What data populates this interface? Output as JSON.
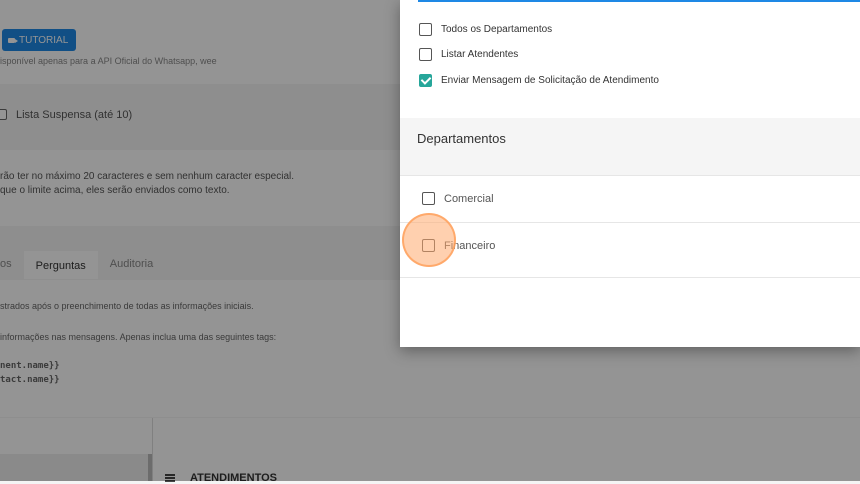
{
  "background": {
    "tutorial_button": "TUTORIAL",
    "api_note": "isponível apenas para a API Oficial do Whatsapp, wee",
    "list_option": "Lista Suspensa (até 10)",
    "rules": [
      "rão ter no máximo 20 caracteres e sem nenhum caracter especial.",
      "que o limite acima, eles serão enviados como texto."
    ],
    "tabs": [
      {
        "label": "os"
      },
      {
        "label": "Perguntas"
      },
      {
        "label": "Auditoria"
      }
    ],
    "notes": [
      "strados após o preenchimento de todas as informações iniciais.",
      "informações nas mensagens. Apenas inclua uma das seguintes tags:"
    ],
    "tags": [
      "nent.name}}",
      "tact.name}}"
    ],
    "atendimentos_label": "ATENDIMENTOS"
  },
  "modal": {
    "options": [
      {
        "label": "Todos os Departamentos",
        "checked": false
      },
      {
        "label": "Listar Atendentes",
        "checked": false
      },
      {
        "label": "Enviar Mensagem de Solicitação de Atendimento",
        "checked": true
      }
    ],
    "departments_title": "Departamentos",
    "departments": [
      {
        "label": "Comercial",
        "checked": false
      },
      {
        "label": "Financeiro",
        "checked": false
      }
    ]
  },
  "colors": {
    "accent_blue": "#1e88e5",
    "check_teal": "#26a69a",
    "click_highlight": "#ffaa6e"
  }
}
